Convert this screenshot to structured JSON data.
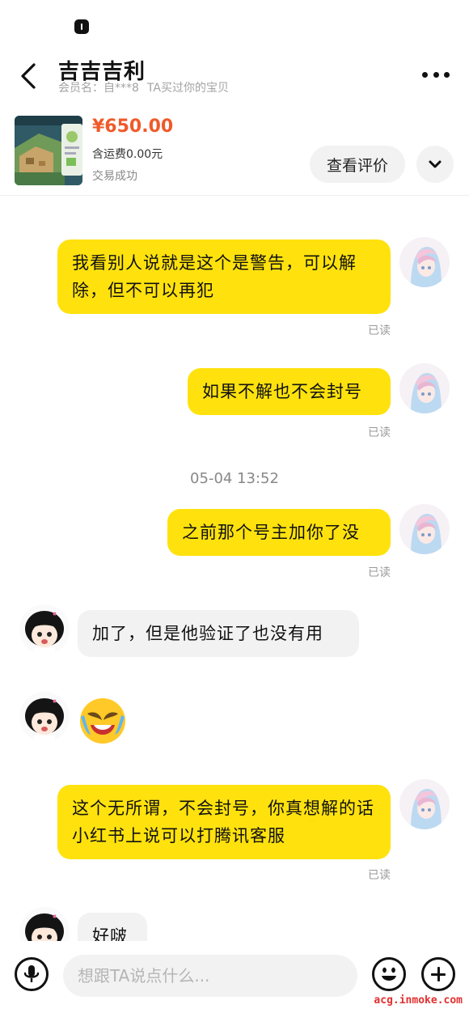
{
  "header": {
    "title": "吉吉吉利",
    "member_label": "会员名：自***8",
    "relation": "TA买过你的宝贝"
  },
  "product": {
    "price": "¥650.00",
    "shipping": "含运费0.00元",
    "status": "交易成功",
    "review_button": "查看评价"
  },
  "messages": [
    {
      "from": "me",
      "text": "我看别人说就是这个是警告，可以解除，但不可以再犯",
      "status": "已读"
    },
    {
      "from": "me",
      "text": "如果不解也不会封号",
      "status": "已读"
    },
    {
      "type": "timestamp",
      "text": "05-04 13:52"
    },
    {
      "from": "me",
      "text": "之前那个号主加你了没",
      "status": "已读"
    },
    {
      "from": "them",
      "text": "加了，但是他验证了也没有用"
    },
    {
      "from": "them",
      "type": "emoji",
      "emoji": "crying-laughing-face"
    },
    {
      "from": "me",
      "text": "这个无所谓，不会封号，你真想解的话小红书上说可以打腾讯客服",
      "status": "已读"
    },
    {
      "from": "them",
      "text": "好啵"
    }
  ],
  "input": {
    "placeholder": "想跟TA说点什么..."
  },
  "watermark": "acg.inmoke.com",
  "colors": {
    "my_bubble": "#ffe20d",
    "their_bubble": "#f2f2f2",
    "price": "#ef5a2a"
  },
  "icons": [
    "back-arrow-icon",
    "more-dots-icon",
    "chevron-down-icon",
    "microphone-icon",
    "smiley-icon",
    "plus-icon"
  ]
}
